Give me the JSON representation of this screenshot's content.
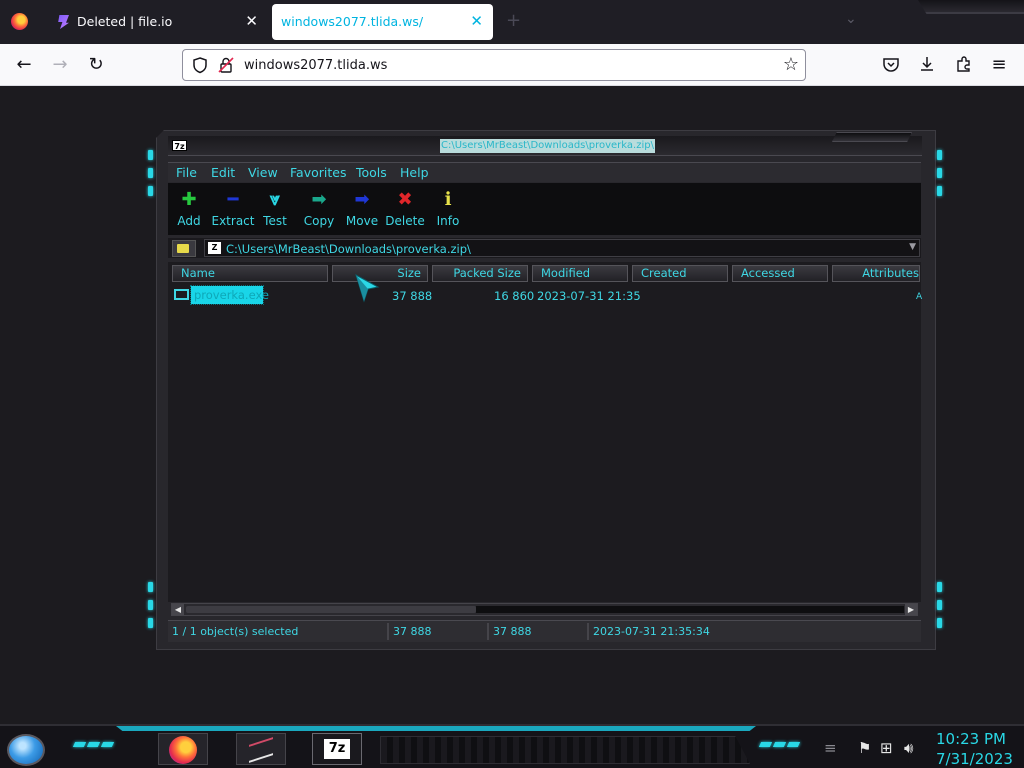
{
  "browser": {
    "tabs": [
      {
        "title": "Deleted | file.io",
        "active": false
      },
      {
        "title": "windows2077.tlida.ws/",
        "active": true
      }
    ],
    "new_tab_symbol": "+",
    "url": "windows2077.tlida.ws",
    "icons": {
      "back": "back-arrow-icon",
      "forward": "forward-arrow-icon",
      "reload": "reload-icon",
      "shield": "tracking-shield-icon",
      "insecure": "insecure-lock-icon",
      "bookmark": "bookmark-star-icon",
      "pocket": "pocket-icon",
      "downloads": "downloads-icon",
      "extensions": "extensions-icon",
      "menu": "hamburger-menu-icon"
    }
  },
  "sevenzip": {
    "title_path": "C:\\Users\\MrBeast\\Downloads\\proverka.zip\\",
    "menu": [
      "File",
      "Edit",
      "View",
      "Favorites",
      "Tools",
      "Help"
    ],
    "toolbar": [
      {
        "label": "Add",
        "icon": "plus-icon",
        "color": "#27c93f"
      },
      {
        "label": "Extract",
        "icon": "minus-icon",
        "color": "#1f37d6"
      },
      {
        "label": "Test",
        "icon": "check-chevron-icon",
        "color": "#29d8e6"
      },
      {
        "label": "Copy",
        "icon": "copy-arrow-icon",
        "color": "#1aa88c"
      },
      {
        "label": "Move",
        "icon": "move-arrow-icon",
        "color": "#1f37d6"
      },
      {
        "label": "Delete",
        "icon": "delete-x-icon",
        "color": "#e0262a"
      },
      {
        "label": "Info",
        "icon": "info-icon",
        "color": "#e6e14a"
      }
    ],
    "address": "C:\\Users\\MrBeast\\Downloads\\proverka.zip\\",
    "columns": [
      "Name",
      "Size",
      "Packed Size",
      "Modified",
      "Created",
      "Accessed",
      "Attributes"
    ],
    "files": [
      {
        "name": "proverka.exe",
        "size": "37 888",
        "packed": "16 860",
        "modified": "2023-07-31 21:35",
        "created": "",
        "accessed": "",
        "attributes": "A"
      }
    ],
    "status": {
      "selection": "1 / 1 object(s) selected",
      "size": "37 888",
      "packed": "37 888",
      "modified": "2023-07-31 21:35:34"
    }
  },
  "taskbar": {
    "apps": [
      {
        "name": "firefox",
        "icon": "firefox-icon"
      },
      {
        "name": "terminal",
        "icon": "terminal-icon"
      },
      {
        "name": "7-zip",
        "icon": "7z-icon",
        "label": "7z"
      }
    ],
    "tray_icons": [
      "flag-icon",
      "network-icon",
      "volume-icon"
    ],
    "time": "10:23 PM",
    "date": "7/31/2023"
  },
  "colors": {
    "accent_cyan": "#29d8e6",
    "text_cyan": "#3fd7e4",
    "window_bg": "#28272c",
    "page_bg": "#1c1b1f"
  }
}
